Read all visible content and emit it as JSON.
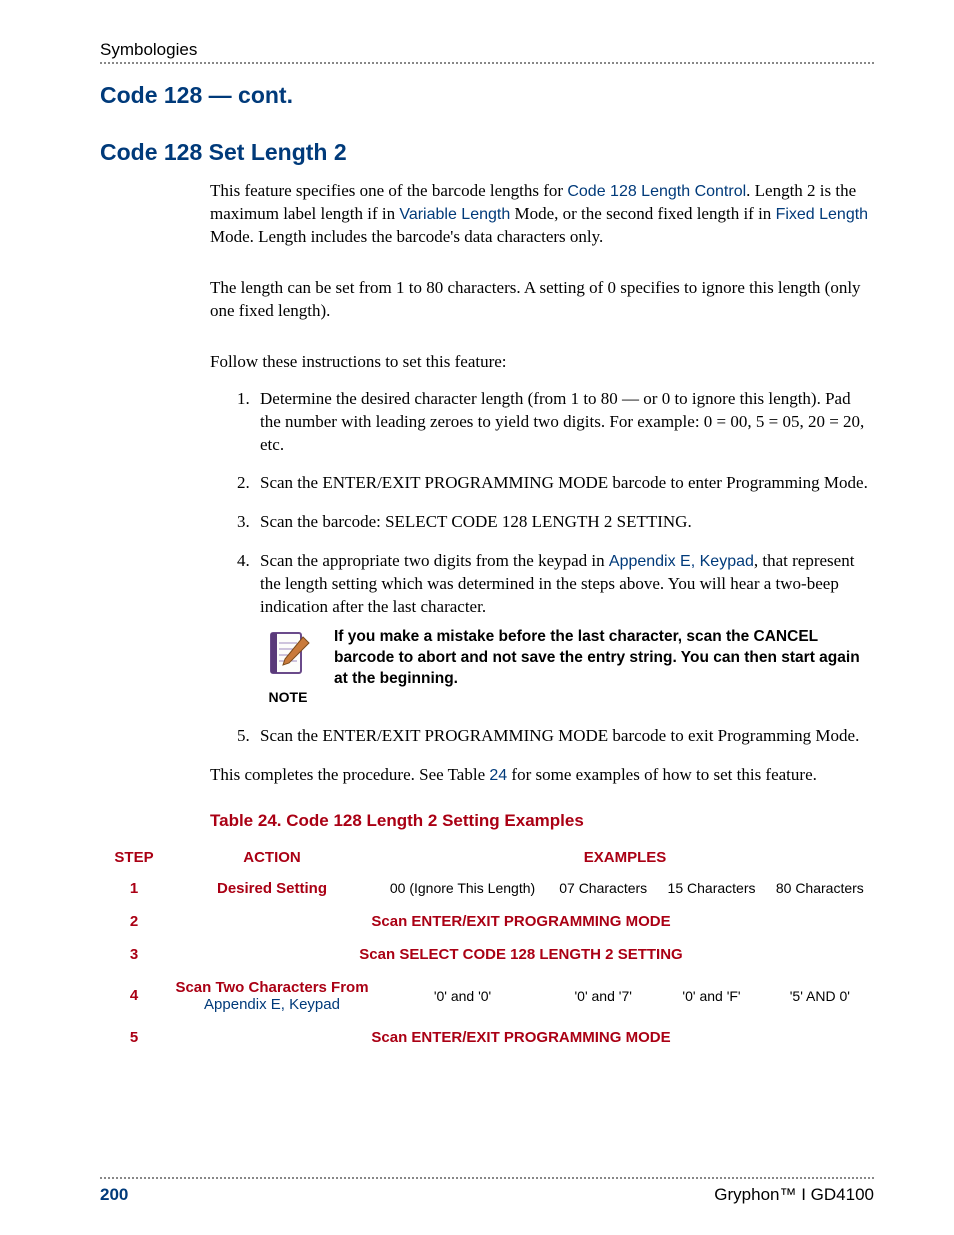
{
  "header": {
    "running": "Symbologies"
  },
  "titles": {
    "cont": "Code 128 — cont.",
    "section": "Code 128 Set Length 2"
  },
  "para": {
    "intro_a": "This feature specifies one of the barcode lengths for ",
    "link_lengthControl": "Code 128 Length Control",
    "intro_b": ". Length 2 is the maximum label length if in ",
    "link_variable": "Variable Length",
    "intro_c": " Mode, or the second fixed length if in ",
    "link_fixed": "Fixed Length",
    "intro_d": " Mode. Length includes the barcode's data characters only.",
    "range": "The length can be set from 1 to 80 characters. A setting of 0 specifies to ignore this length (only one fixed length).",
    "follow": "Follow these instructions to set this feature:"
  },
  "steps": {
    "s1": "Determine the desired character length (from 1 to 80 — or 0 to ignore this length). Pad the number with leading zeroes to yield two digits. For example: 0 = 00, 5 = 05, 20 = 20, etc.",
    "s2": "Scan the ENTER/EXIT PROGRAMMING MODE barcode to enter Programming Mode.",
    "s3": "Scan the barcode: SELECT CODE 128 LENGTH 2 SETTING.",
    "s4a": "Scan the appropriate two digits from the keypad in ",
    "s4link": "Appendix E, Keypad",
    "s4b": ", that represent the length setting which was determined in the steps above. You will hear a two-beep indication after the last character.",
    "s5": "Scan the ENTER/EXIT PROGRAMMING MODE barcode to exit Programming Mode."
  },
  "note": {
    "label": "NOTE",
    "text": "If you make a mistake before the last character, scan the CANCEL barcode to abort and not save the entry string. You can then start again at the beginning."
  },
  "closing": {
    "a": "This completes the procedure. See Table ",
    "link": "24",
    "b": " for some examples of how to set this feature."
  },
  "table": {
    "caption": "Table 24. Code 128 Length 2 Setting Examples",
    "head_step": "STEP",
    "head_action": "ACTION",
    "head_examples": "EXAMPLES",
    "r1_action": "Desired Setting",
    "r1_c1": "00 (Ignore This Length)",
    "r1_c2": "07 Characters",
    "r1_c3": "15 Characters",
    "r1_c4": "80 Characters",
    "r2": "Scan ENTER/EXIT PROGRAMMING MODE",
    "r3": "Scan SELECT CODE 128 LENGTH 2 SETTING",
    "r4_action_a": "Scan Two Characters From ",
    "r4_action_link": "Appendix E, Keypad",
    "r4_c1": "'0' and '0'",
    "r4_c2": "'0' and '7'",
    "r4_c3": "'0' and 'F'",
    "r4_c4": "'5' AND 0'",
    "r5": "Scan ENTER/EXIT PROGRAMMING MODE",
    "n1": "1",
    "n2": "2",
    "n3": "3",
    "n4": "4",
    "n5": "5"
  },
  "footer": {
    "page": "200",
    "product": "Gryphon™ I GD4100"
  }
}
